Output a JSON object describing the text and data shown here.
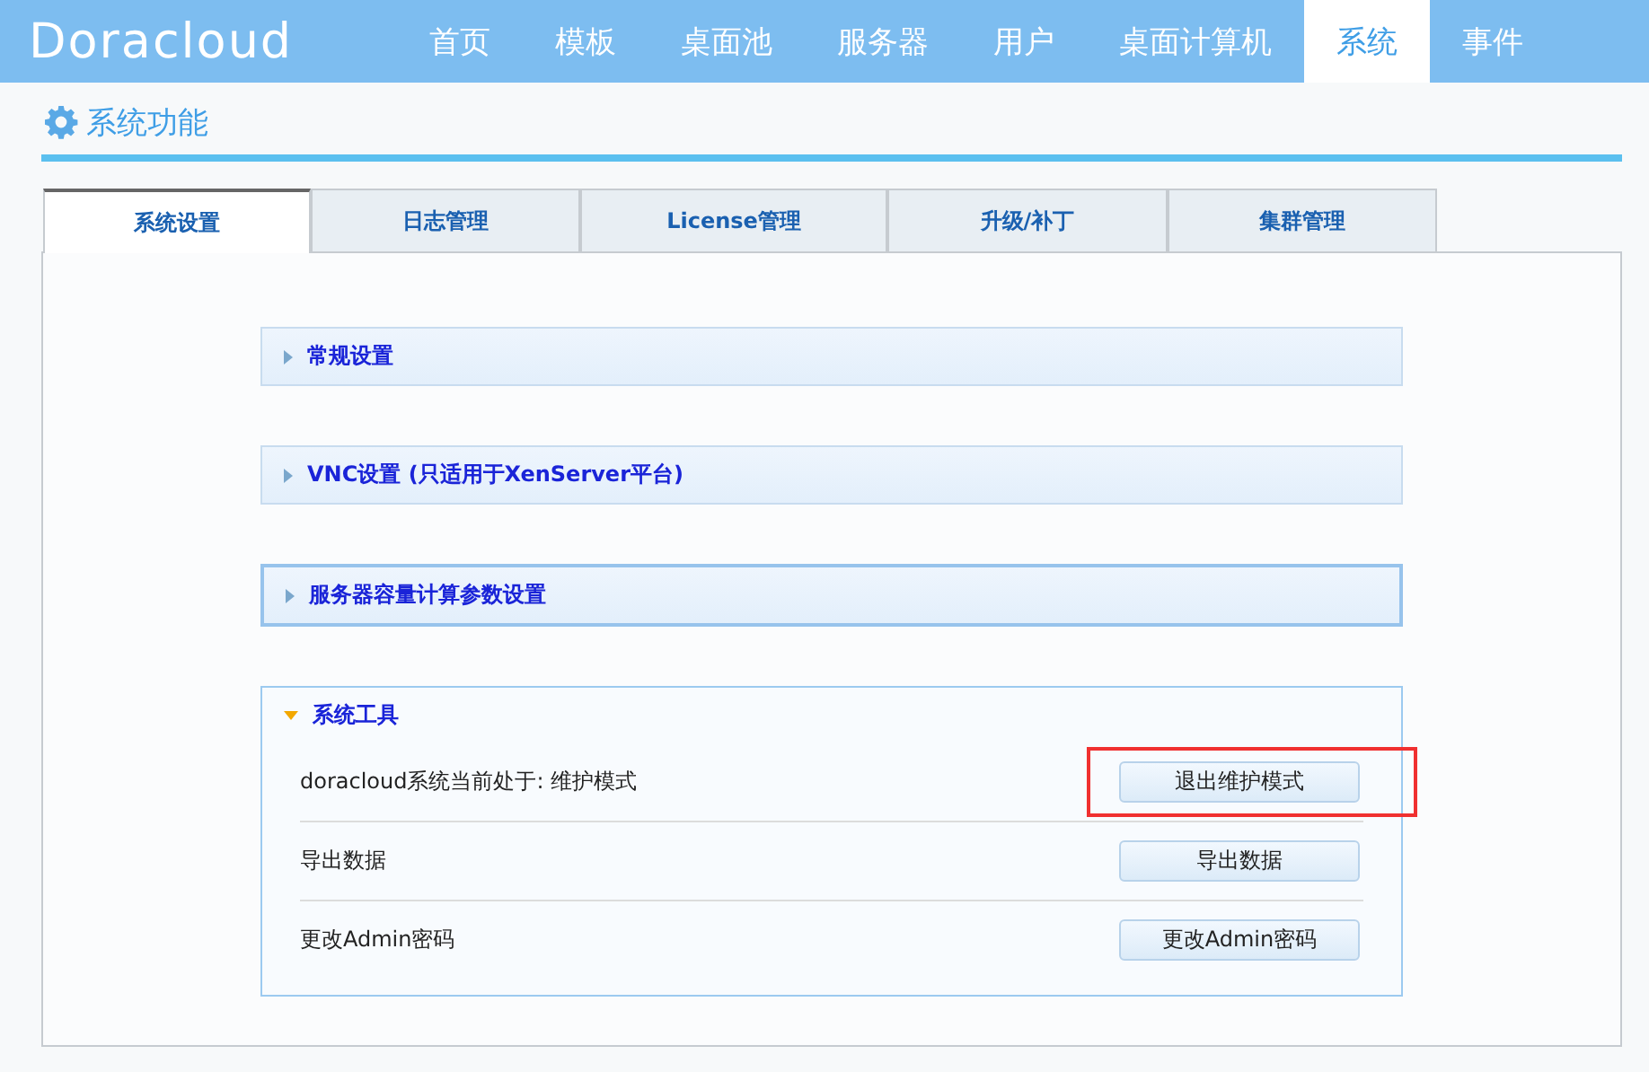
{
  "header": {
    "logo": "Doracloud",
    "nav": [
      {
        "label": "首页",
        "selected": false
      },
      {
        "label": "模板",
        "selected": false
      },
      {
        "label": "桌面池",
        "selected": false
      },
      {
        "label": "服务器",
        "selected": false
      },
      {
        "label": "用户",
        "selected": false
      },
      {
        "label": "桌面计算机",
        "selected": false
      },
      {
        "label": "系统",
        "selected": true
      },
      {
        "label": "事件",
        "selected": false
      }
    ]
  },
  "page_title": "系统功能",
  "tabs": [
    {
      "label": "系统设置",
      "selected": true
    },
    {
      "label": "日志管理",
      "selected": false
    },
    {
      "label": "License管理",
      "selected": false
    },
    {
      "label": "升级/补丁",
      "selected": false
    },
    {
      "label": "集群管理",
      "selected": false
    }
  ],
  "sections": [
    {
      "title": "常规设置",
      "expanded": false,
      "focused": false
    },
    {
      "title": "VNC设置 (只适用于XenServer平台)",
      "expanded": false,
      "focused": false
    },
    {
      "title": "服务器容量计算参数设置",
      "expanded": false,
      "focused": true
    },
    {
      "title": "系统工具",
      "expanded": true,
      "focused": false,
      "rows": [
        {
          "label": "doracloud系统当前处于: 维护模式",
          "button": "退出维护模式",
          "highlighted": true
        },
        {
          "label": "导出数据",
          "button": "导出数据",
          "highlighted": false
        },
        {
          "label": "更改Admin密码",
          "button": "更改Admin密码",
          "highlighted": false
        }
      ]
    }
  ]
}
